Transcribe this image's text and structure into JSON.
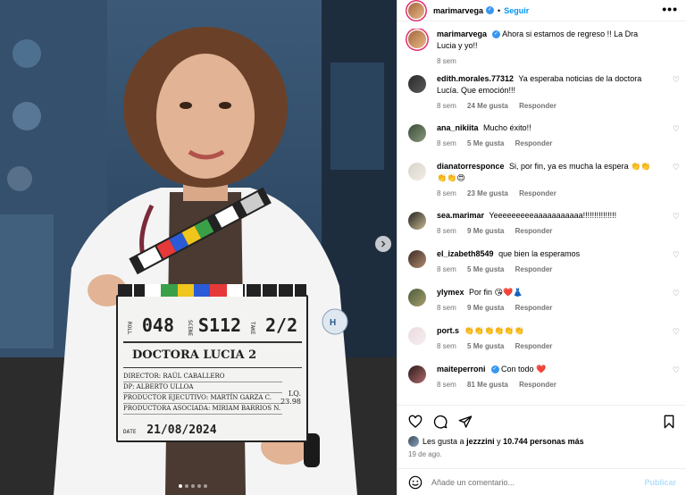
{
  "post": {
    "author": "marimarvega",
    "follow_label": "Seguir",
    "dot": "•",
    "more_label": "•••",
    "caption": {
      "username": "marimarvega",
      "text": "Ahora si estamos de regreso !! La Dra Lucia y yo!!",
      "time": "8 sem"
    }
  },
  "media": {
    "slate": {
      "roll_label": "ROLL",
      "roll": "048",
      "scene_label": "SCENE",
      "scene": "S112",
      "take_label": "TAKE",
      "take": "2/2",
      "production": "DOCTORA LUCIA 2",
      "director": "DIRECTOR: RAÚL CABALLERO",
      "dp": "DP: ALBERTO ULLOA",
      "exec_producer": "PRODUCTOR EJECUTIVO: MARTÍN GARZA C.",
      "assoc_producer": "PRODUCTORA ASOCIADA: MIRIAM BARRIOS N.",
      "lq": "LQ.",
      "fps": "23.98",
      "date_label": "DATE",
      "date": "21/08/2024"
    },
    "carousel_dots": 5,
    "active_dot": 0,
    "next_icon": "chevron-right-icon"
  },
  "comments": [
    {
      "username": "edith.morales.77312",
      "verified": false,
      "text": "Ya esperaba noticias de la doctora Lucía. Que emoción!!!",
      "time": "8 sem",
      "likes": "24 Me gusta",
      "reply": "Responder"
    },
    {
      "username": "ana_nikiita",
      "verified": false,
      "text": "Mucho éxito!!",
      "time": "8 sem",
      "likes": "5 Me gusta",
      "reply": "Responder"
    },
    {
      "username": "dianatorresponce",
      "verified": false,
      "text": "Si, por fin, ya es mucha la espera 👏👏👏👏😍",
      "time": "8 sem",
      "likes": "23 Me gusta",
      "reply": "Responder"
    },
    {
      "username": "sea.marimar",
      "verified": false,
      "text": "Yeeeeeeeeeaaaaaaaaaaa!!!!!!!!!!!!!!!",
      "time": "8 sem",
      "likes": "9 Me gusta",
      "reply": "Responder"
    },
    {
      "username": "el_izabeth8549",
      "verified": false,
      "text": "que bien la esperamos",
      "time": "8 sem",
      "likes": "5 Me gusta",
      "reply": "Responder"
    },
    {
      "username": "ylymex",
      "verified": false,
      "text": "Por fin 😘❤️👗",
      "time": "8 sem",
      "likes": "9 Me gusta",
      "reply": "Responder"
    },
    {
      "username": "port.s",
      "verified": false,
      "text": "👏👏👏👏👏👏",
      "time": "8 sem",
      "likes": "5 Me gusta",
      "reply": "Responder"
    },
    {
      "username": "maiteperroni",
      "verified": true,
      "text": "Con todo ❤️",
      "time": "8 sem",
      "likes": "81 Me gusta",
      "reply": "Responder"
    }
  ],
  "likes": {
    "prefix": "Les gusta a",
    "user": "jezzzini",
    "middle": "y",
    "count": "10.744 personas más"
  },
  "post_date": "19 de ago.",
  "composer": {
    "placeholder": "Añade un comentario...",
    "publish": "Publicar"
  },
  "colors": {
    "link": "#0095f6",
    "verified": "#3897f0",
    "muted": "#737373",
    "publish_disabled": "#b2dffc"
  }
}
